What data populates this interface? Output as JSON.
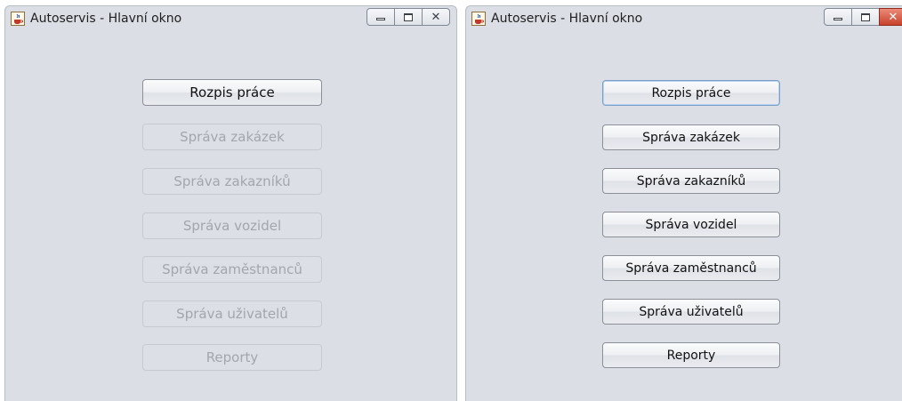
{
  "windows": [
    {
      "title": "Autoservis - Hlavní okno",
      "icon": "java-cup-icon",
      "controls": {
        "minimize": "minimize-icon",
        "maximize": "maximize-icon",
        "close": "close-icon"
      },
      "buttons": [
        {
          "label": "Rozpis práce",
          "enabled": true
        },
        {
          "label": "Správa zakázek",
          "enabled": false
        },
        {
          "label": "Správa zakazníků",
          "enabled": false
        },
        {
          "label": "Správa vozidel",
          "enabled": false
        },
        {
          "label": "Správa zaměstnanců",
          "enabled": false
        },
        {
          "label": "Správa uživatelů",
          "enabled": false
        },
        {
          "label": "Reporty",
          "enabled": false
        }
      ]
    },
    {
      "title": "Autoservis - Hlavní okno",
      "icon": "java-cup-icon",
      "controls": {
        "minimize": "minimize-icon",
        "maximize": "maximize-icon",
        "close": "close-icon",
        "close_color": "#c8412c"
      },
      "buttons": [
        {
          "label": "Rozpis práce",
          "enabled": true,
          "focused": true
        },
        {
          "label": "Správa zakázek",
          "enabled": true
        },
        {
          "label": "Správa zakazníků",
          "enabled": true
        },
        {
          "label": "Správa vozidel",
          "enabled": true
        },
        {
          "label": "Správa zaměstnanců",
          "enabled": true
        },
        {
          "label": "Správa uživatelů",
          "enabled": true
        },
        {
          "label": "Reporty",
          "enabled": true
        }
      ]
    }
  ]
}
